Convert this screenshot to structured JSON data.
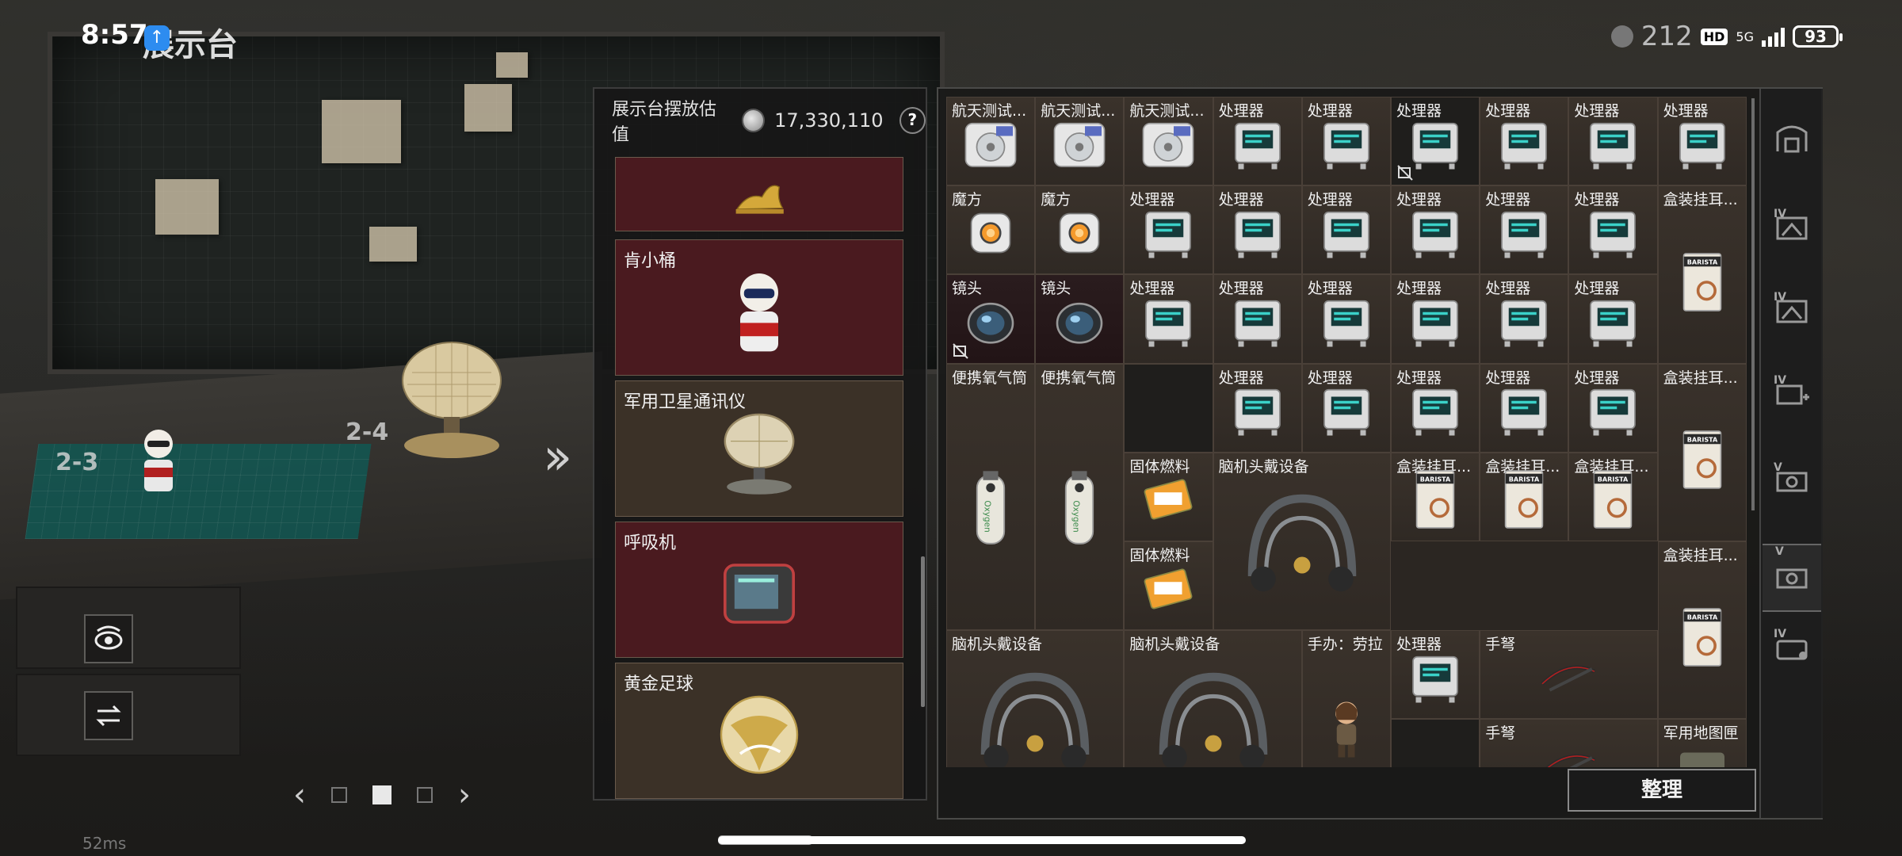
{
  "status_bar": {
    "time": "8:57",
    "ping_text": "212",
    "network": "5G",
    "hd_badge": "HD",
    "battery": "93"
  },
  "header": {
    "title": "展示台"
  },
  "scene": {
    "slot_labels": [
      "2-3",
      "2-4"
    ],
    "ping": "52ms"
  },
  "display_panel": {
    "value_label": "展示台摆放估值",
    "value": "17,330,110",
    "help": "?",
    "items": [
      {
        "name": "",
        "color": "#4a1a1f",
        "icon": "golden-leopard-statue-icon"
      },
      {
        "name": "肯小桶",
        "color": "#4a1a1f",
        "icon": "kfc-colonel-figure-icon"
      },
      {
        "name": "军用卫星通讯仪",
        "color": "#3b3127",
        "icon": "satellite-dish-icon"
      },
      {
        "name": "呼吸机",
        "color": "#4a1a1f",
        "icon": "ventilator-icon"
      },
      {
        "name": "黄金足球",
        "color": "#3b3127",
        "icon": "golden-football-icon"
      }
    ]
  },
  "inventory": {
    "cells": [
      {
        "name": "航天测试...",
        "icon": "disk-drive-icon"
      },
      {
        "name": "航天测试...",
        "icon": "disk-drive-icon"
      },
      {
        "name": "航天测试...",
        "icon": "disk-drive-icon"
      },
      {
        "name": "处理器",
        "icon": "processor-icon"
      },
      {
        "name": "处理器",
        "icon": "processor-icon"
      },
      {
        "name": "处理器",
        "icon": "processor-icon"
      },
      {
        "name": "处理器",
        "icon": "processor-icon"
      },
      {
        "name": "处理器",
        "icon": "processor-icon"
      },
      {
        "name": "处理器",
        "icon": "processor-icon"
      },
      {
        "name": "魔方",
        "icon": "cube-icon"
      },
      {
        "name": "魔方",
        "icon": "cube-icon"
      },
      {
        "name": "处理器",
        "icon": "processor-icon"
      },
      {
        "name": "处理器",
        "icon": "processor-icon"
      },
      {
        "name": "处理器",
        "icon": "processor-icon"
      },
      {
        "name": "处理器",
        "icon": "processor-icon"
      },
      {
        "name": "处理器",
        "icon": "processor-icon"
      },
      {
        "name": "处理器",
        "icon": "processor-icon"
      },
      {
        "name": "盒装挂耳...",
        "icon": "coffee-box-icon"
      },
      {
        "name": "镜头",
        "icon": "lens-icon"
      },
      {
        "name": "镜头",
        "icon": "lens-icon"
      },
      {
        "name": "处理器",
        "icon": "processor-icon"
      },
      {
        "name": "处理器",
        "icon": "processor-icon"
      },
      {
        "name": "处理器",
        "icon": "processor-icon"
      },
      {
        "name": "处理器",
        "icon": "processor-icon"
      },
      {
        "name": "处理器",
        "icon": "processor-icon"
      },
      {
        "name": "处理器",
        "icon": "processor-icon"
      },
      {
        "name": "便携氧气筒",
        "icon": "oxygen-tank-icon"
      },
      {
        "name": "便携氧气筒",
        "icon": "oxygen-tank-icon"
      },
      {
        "name": "处理器",
        "icon": "processor-icon"
      },
      {
        "name": "处理器",
        "icon": "processor-icon"
      },
      {
        "name": "处理器",
        "icon": "processor-icon"
      },
      {
        "name": "处理器",
        "icon": "processor-icon"
      },
      {
        "name": "处理器",
        "icon": "processor-icon"
      },
      {
        "name": "盒装挂耳...",
        "icon": "coffee-box-icon"
      },
      {
        "name": "固体燃料",
        "icon": "solid-fuel-icon"
      },
      {
        "name": "脑机头戴设备",
        "icon": "headset-icon"
      },
      {
        "name": "盒装挂耳...",
        "icon": "coffee-box-icon"
      },
      {
        "name": "盒装挂耳...",
        "icon": "coffee-box-icon"
      },
      {
        "name": "盒装挂耳...",
        "icon": "coffee-box-icon"
      },
      {
        "name": "固体燃料",
        "icon": "solid-fuel-icon"
      },
      {
        "name": "盒装挂耳...",
        "icon": "coffee-box-icon"
      },
      {
        "name": "脑机头戴设备",
        "icon": "headset-icon"
      },
      {
        "name": "脑机头戴设备",
        "icon": "headset-icon"
      },
      {
        "name": "手办：劳拉",
        "icon": "lara-figure-icon"
      },
      {
        "name": "处理器",
        "icon": "processor-icon"
      },
      {
        "name": "手弩",
        "icon": "crossbow-icon"
      },
      {
        "name": "手弩",
        "icon": "crossbow-icon"
      },
      {
        "name": "军用地图匣",
        "icon": "map-case-icon"
      }
    ],
    "sort_label": "整理",
    "side_tabs": [
      {
        "icon": "outpost-icon",
        "label": ""
      },
      {
        "icon": "tier-iv-mountain-icon",
        "label": "IV"
      },
      {
        "icon": "tier-iv-mountain-alt-icon",
        "label": "IV"
      },
      {
        "icon": "tier-iv-add-icon",
        "label": "IV"
      },
      {
        "icon": "tier-v-camera-icon",
        "label": "V"
      },
      {
        "icon": "tier-v-camera-active-icon",
        "label": "V"
      },
      {
        "icon": "tier-iv-case-icon",
        "label": "IV"
      }
    ]
  },
  "pager": {
    "prev": "‹",
    "next": "›"
  },
  "colors": {
    "cell_brown": "#3a322b",
    "cell_red": "#3f1c20",
    "accent_teal": "#0f5a55"
  }
}
